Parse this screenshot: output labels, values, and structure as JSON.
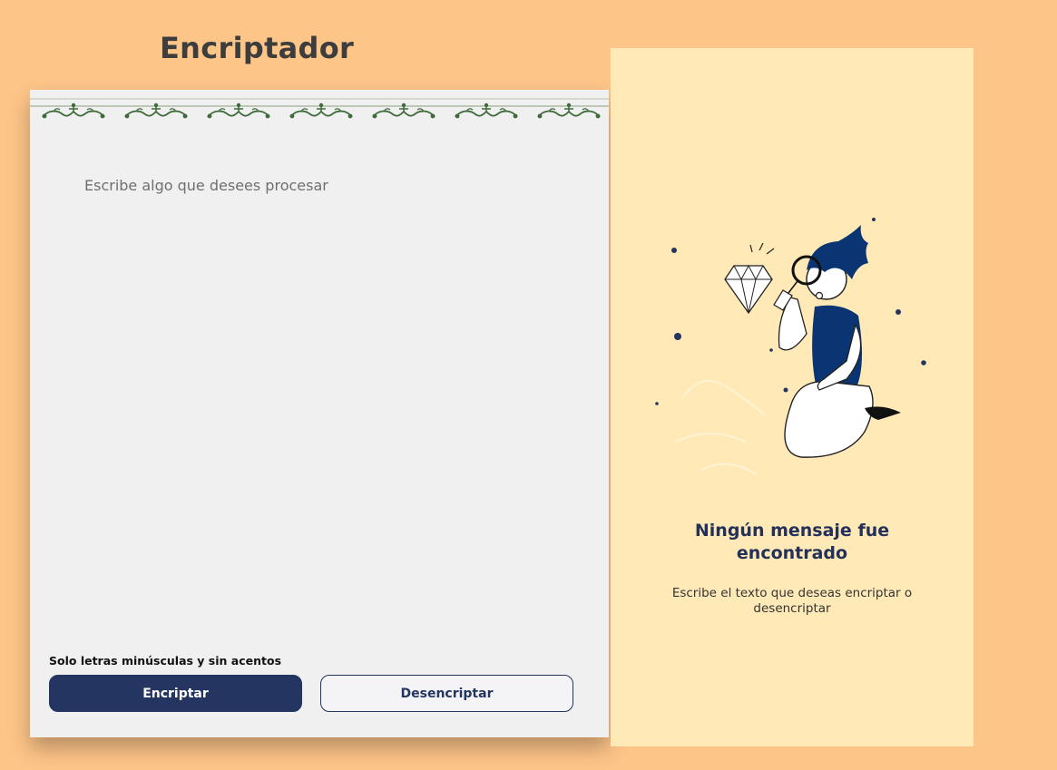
{
  "header": {
    "title": "Encriptador"
  },
  "editor": {
    "placeholder": "Escribe algo que desees procesar",
    "hint": "Solo letras minúsculas y sin acentos",
    "encrypt_label": "Encriptar",
    "decrypt_label": "Desencriptar"
  },
  "result": {
    "title": "Ningún mensaje fue encontrado",
    "subtitle": "Escribe el texto que deseas encriptar o desencriptar"
  },
  "colors": {
    "background": "#fec588",
    "accent": "#233560",
    "panel": "#ffe9b6",
    "editor": "#f0f0f0",
    "ornament": "#3f6b3a"
  },
  "icons": [
    "ornament-vine-icon",
    "detective-illustration-icon",
    "diamond-icon",
    "magnifier-icon"
  ]
}
